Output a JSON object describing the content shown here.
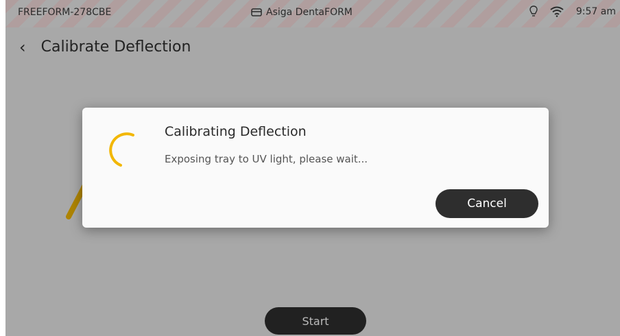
{
  "statusbar": {
    "device_name": "FREEFORM-278CBE",
    "printer_name": "Asiga DentaFORM",
    "time": "9:57 am"
  },
  "header": {
    "back_icon": "chevron-left-icon",
    "title": "Calibrate Deflection"
  },
  "dialog": {
    "title": "Calibrating Deflection",
    "message": "Exposing tray to UV light, please wait...",
    "cancel_label": "Cancel",
    "spinner_color": "#f2b705"
  },
  "footer": {
    "start_label": "Start"
  },
  "colors": {
    "stripe": "#f4dcdc",
    "button": "#2e2e2e",
    "accent": "#f2b705"
  }
}
